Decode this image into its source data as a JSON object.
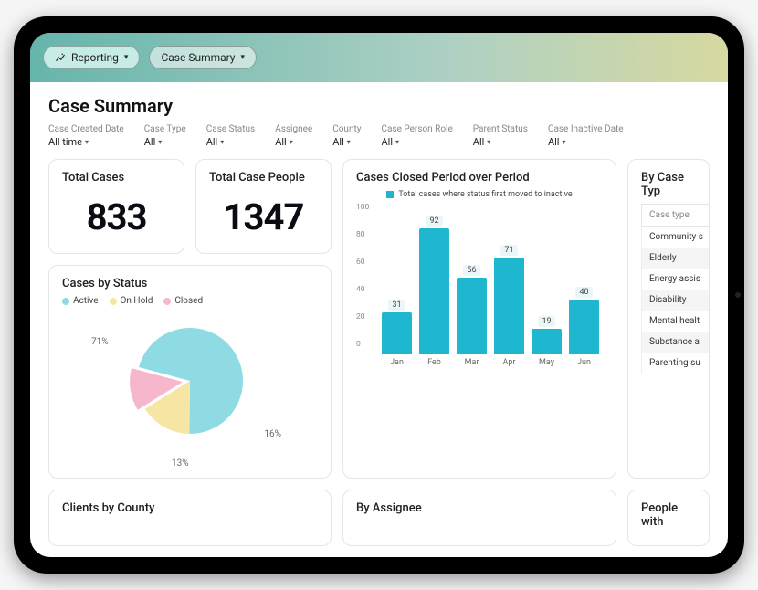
{
  "topbar": {
    "reporting_label": "Reporting",
    "case_summary_label": "Case Summary"
  },
  "page_title": "Case Summary",
  "filters": [
    {
      "label": "Case Created Date",
      "value": "All time"
    },
    {
      "label": "Case Type",
      "value": "All"
    },
    {
      "label": "Case Status",
      "value": "All"
    },
    {
      "label": "Assignee",
      "value": "All"
    },
    {
      "label": "County",
      "value": "All"
    },
    {
      "label": "Case Person Role",
      "value": "All"
    },
    {
      "label": "Parent Status",
      "value": "All"
    },
    {
      "label": "Case Inactive Date",
      "value": "All"
    }
  ],
  "kpi": {
    "total_cases_label": "Total Cases",
    "total_cases_value": "833",
    "total_people_label": "Total Case People",
    "total_people_value": "1347"
  },
  "status_card": {
    "title": "Cases by Status",
    "legend": [
      {
        "name": "Active",
        "color": "#8fdbe4"
      },
      {
        "name": "On Hold",
        "color": "#f7e6a3"
      },
      {
        "name": "Closed",
        "color": "#f6b7cd"
      }
    ],
    "labels": {
      "active": "71%",
      "onhold": "16%",
      "closed": "13%"
    }
  },
  "closed_card": {
    "title": "Cases Closed Period over Period",
    "legend": "Total cases where status first moved to inactive",
    "yticks": [
      "100",
      "80",
      "60",
      "40",
      "20",
      "0"
    ]
  },
  "casetype_card": {
    "title": "By Case Typ",
    "header": "Case type",
    "rows": [
      "Community s",
      "Elderly",
      "Energy assis",
      "Disability",
      "Mental healt",
      "Substance a",
      "Parenting su"
    ]
  },
  "bottom": {
    "clients_county": "Clients by County",
    "by_assignee": "By Assignee",
    "people_with": "People with"
  },
  "chart_data": [
    {
      "type": "pie",
      "title": "Cases by Status",
      "series": [
        {
          "name": "Active",
          "value": 71,
          "color": "#8fdbe4"
        },
        {
          "name": "On Hold",
          "value": 16,
          "color": "#f7e6a3"
        },
        {
          "name": "Closed",
          "value": 13,
          "color": "#f6b7cd"
        }
      ]
    },
    {
      "type": "bar",
      "title": "Cases Closed Period over Period",
      "legend": "Total cases where status first moved to inactive",
      "categories": [
        "Jan",
        "Feb",
        "Mar",
        "Apr",
        "May",
        "Jun"
      ],
      "values": [
        31,
        92,
        56,
        71,
        19,
        40
      ],
      "ylabel": "",
      "xlabel": "",
      "ylim": [
        0,
        100
      ]
    }
  ]
}
